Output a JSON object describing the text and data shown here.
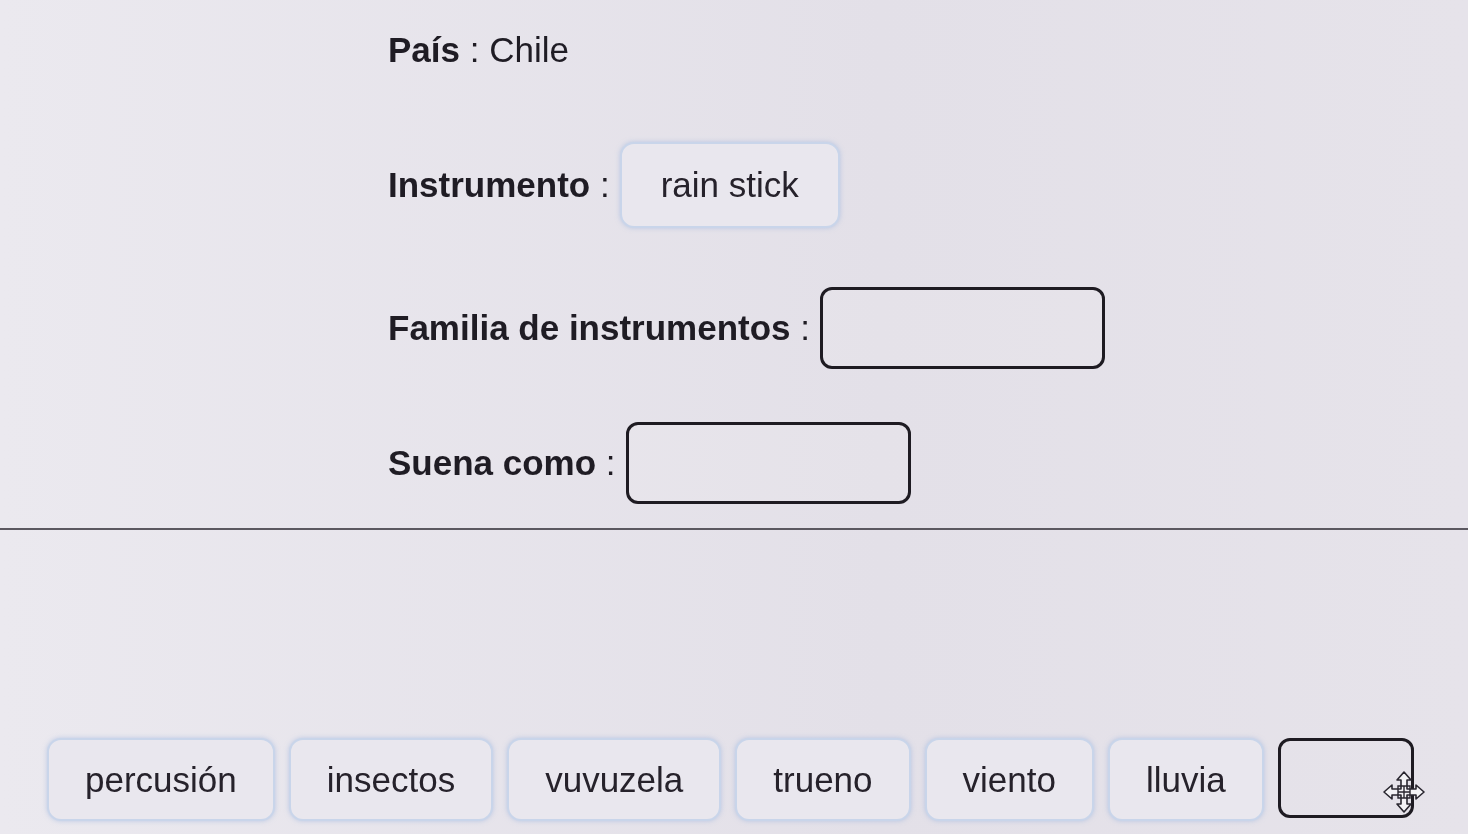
{
  "country": {
    "text": "**País** : Chile"
  },
  "fields": [
    {
      "label": "**Instrumento** :",
      "kind": "chip",
      "value": "rain stick"
    },
    {
      "label": "**Familia de instrumentos** :",
      "kind": "blank"
    },
    {
      "label": "**Suena como** :",
      "kind": "blank"
    }
  ],
  "word_bank": [
    {
      "kind": "word",
      "text": "percusión"
    },
    {
      "kind": "word",
      "text": "insectos"
    },
    {
      "kind": "word",
      "text": "vuvuzela"
    },
    {
      "kind": "word",
      "text": "trueno"
    },
    {
      "kind": "word",
      "text": "viento"
    },
    {
      "kind": "word",
      "text": "lluvia"
    },
    {
      "kind": "blank",
      "cursor_over": true
    }
  ]
}
